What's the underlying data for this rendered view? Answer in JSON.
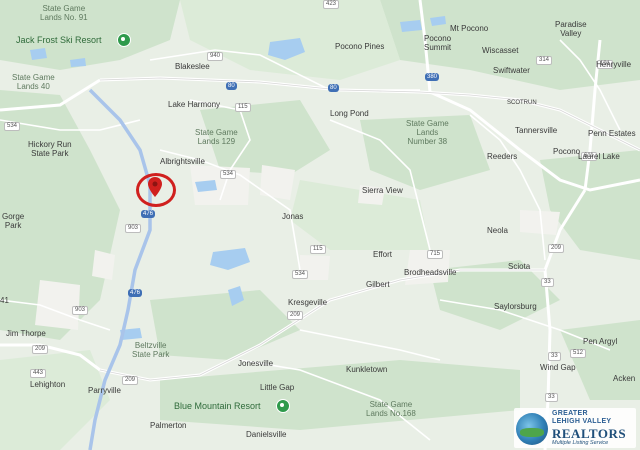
{
  "marker_color": "#d0201e",
  "poi_color": "#2e9a4b",
  "labels": {
    "state_game_lands_91": "State Game\nLands No. 91",
    "jack_frost": "Jack Frost Ski Resort",
    "state_game_lands_40": "State Game\nLands 40",
    "hickory_run": "Hickory Run\nState Park",
    "blakeslee": "Blakeslee",
    "lake_harmony": "Lake Harmony",
    "state_game_lands_129": "State Game\nLands 129",
    "albrightsville": "Albrightsville",
    "pocono_pines": "Pocono Pines",
    "mt_pocono": "Mt Pocono",
    "pocono_summit": "Pocono\nSummit",
    "wiscasset": "Wiscasset",
    "paradise_valley": "Paradise\nValley",
    "swiftwater": "Swiftwater",
    "henryville": "Henryville",
    "long_pond": "Long Pond",
    "state_game_lands_38": "State Game\nLands\nNumber 38",
    "scotrun": "SCOTRUN",
    "tannersville": "Tannersville",
    "penn_estates": "Penn Estates",
    "reeders": "Reeders",
    "pocono": "Pocono",
    "laurel_lake": "Laurel Lake",
    "gorge_park": "Gorge\nPark",
    "sierra_view": "Sierra View",
    "jonas": "Jonas",
    "neola": "Neola",
    "effort": "Effort",
    "brodheadsville": "Brodheadsville",
    "sciota": "Sciota",
    "gilbert": "Gilbert",
    "kresgeville": "Kresgeville",
    "saylorsburg": "Saylorsburg",
    "jim_thorpe": "Jim Thorpe",
    "beltzville": "Beltzville\nState Park",
    "pen_argyl": "Pen Argyl",
    "lehighton": "Lehighton",
    "jonesville": "Jonesville",
    "kunkletown": "Kunkletown",
    "wind_gap": "Wind Gap",
    "little_gap": "Little Gap",
    "parryville": "Parryville",
    "blue_mountain": "Blue Mountain Resort",
    "state_game_lands_168": "State Game\nLands No.168",
    "ackerman": "Acken",
    "palmerton": "Palmerton",
    "danielsville": "Danielsville",
    "edge_41": "41"
  },
  "shields": {
    "r423": "423",
    "r940": "940",
    "i80a": "80",
    "i80b": "80",
    "i380": "380",
    "r314": "314",
    "r191": "191",
    "r534a": "534",
    "r115a": "115",
    "r534b": "534",
    "i476a": "476",
    "r903a": "903",
    "r611": "611",
    "r715": "715",
    "r209a": "209",
    "i476b": "476",
    "r903b": "903",
    "r209b": "209",
    "r33a": "33",
    "r33b": "33",
    "r512": "512",
    "r209c": "209",
    "r209d": "209",
    "r443": "443",
    "r33c": "33",
    "r534c": "534",
    "r115b": "115"
  },
  "logo": {
    "line1": "GREATER",
    "line1b": "LEHIGH VALLEY",
    "line2": "REALTORS",
    "line3": "Multiple Listing Service"
  }
}
